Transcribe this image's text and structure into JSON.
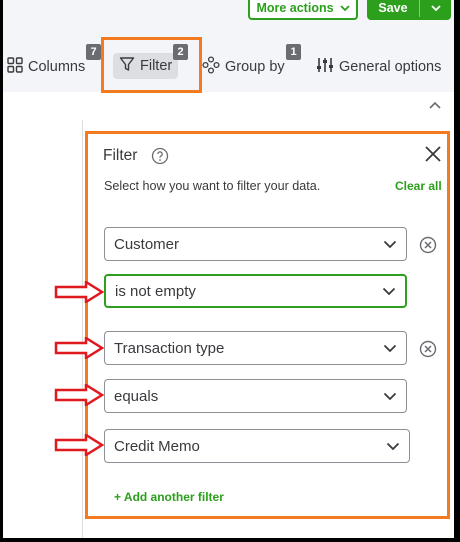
{
  "header": {
    "more_actions_label": "More actions",
    "save_label": "Save"
  },
  "toolbar": {
    "columns_label": "Columns",
    "columns_count": "7",
    "filter_label": "Filter",
    "filter_count": "2",
    "groupby_label": "Group by",
    "groupby_count": "1",
    "general_options_label": "General options"
  },
  "filter_panel": {
    "title": "Filter",
    "description": "Select how you want to filter your data.",
    "clear_all_label": "Clear all",
    "filters": [
      {
        "field": "Customer",
        "operator": "is not empty"
      },
      {
        "field": "Transaction type",
        "operator": "equals",
        "value": "Credit Memo"
      }
    ],
    "add_filter_label": "+ Add another filter"
  },
  "colors": {
    "brand_green": "#2ca01c",
    "highlight_orange": "#f47a20",
    "annotation_red": "#e0191f",
    "text": "#393a3d"
  }
}
